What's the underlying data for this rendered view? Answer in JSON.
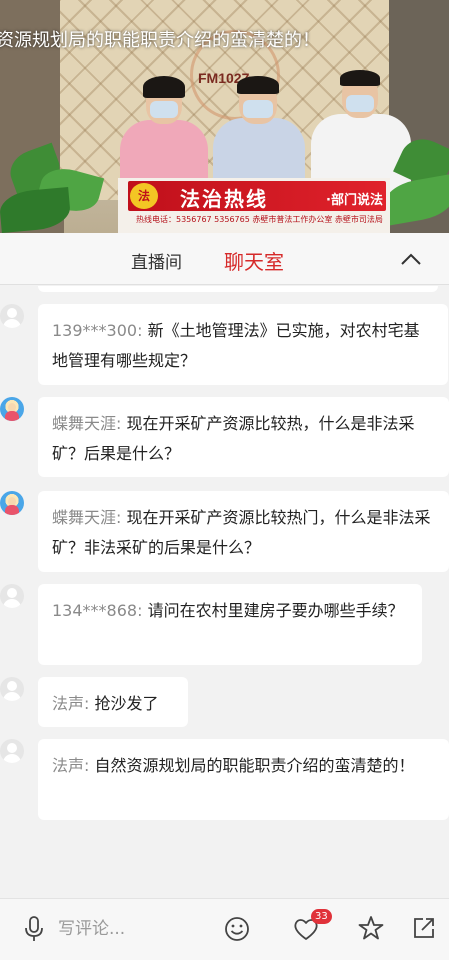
{
  "video": {
    "ticker_text": "资源规划局的职能职责介绍的蛮清楚的！",
    "station_label": "FM1027",
    "banner_title": "法治热线",
    "banner_subtitle": "·部门说法",
    "banner_logo": "法",
    "hotline_line": "热线电话：5356767  5356765     赤壁市普法工作办公室   赤壁市司法局"
  },
  "tabs": [
    {
      "label": "直播间"
    },
    {
      "label": "聊天室"
    }
  ],
  "messages": [
    {
      "nick": "139***300:",
      "text": "新《土地管理法》已实施，对农村宅基地管理有哪些规定？"
    },
    {
      "nick": "蝶舞天涯:",
      "text": "现在开采矿产资源比较热，什么是非法采矿？后果是什么？"
    },
    {
      "nick": "蝶舞天涯:",
      "text": "现在开采矿产资源比较热门，什么是非法采矿？非法采矿的后果是什么？"
    },
    {
      "nick": "134***868:",
      "text": "请问在农村里建房子要办哪些手续？"
    },
    {
      "nick": "法声:",
      "text": "抢沙发了"
    },
    {
      "nick": "法声:",
      "text": "自然资源规划局的职能职责介绍的蛮清楚的！"
    }
  ],
  "bottom": {
    "comment_placeholder": "写评论...",
    "like_count": "33"
  },
  "colors": {
    "active_tab": "#d62a2a",
    "badge": "#e0323a",
    "nick": "#8a8a8a"
  }
}
